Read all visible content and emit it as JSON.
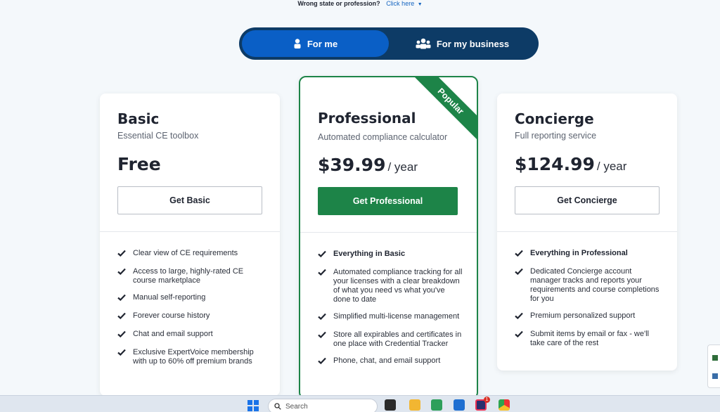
{
  "topnote": {
    "question": "Wrong state or profession?",
    "link": "Click here"
  },
  "toggle": {
    "options": [
      {
        "label": "For me",
        "icon": "person-icon",
        "active": true
      },
      {
        "label": "For my business",
        "icon": "group-icon",
        "active": false
      }
    ]
  },
  "colors": {
    "navy": "#0d3b66",
    "blue": "#0a5fc6",
    "green": "#1d8448"
  },
  "plans": [
    {
      "name": "Basic",
      "subtitle": "Essential CE toolbox",
      "price": "Free",
      "per": "",
      "button": "Get Basic",
      "features": [
        "Clear view of CE requirements",
        "Access to large, highly-rated CE course marketplace",
        "Manual self-reporting",
        "Forever course history",
        "Chat and email support",
        "Exclusive ExpertVoice membership with up to 60% off premium brands"
      ]
    },
    {
      "name": "Professional",
      "subtitle": "Automated compliance calculator",
      "price": "$39.99",
      "per": "/ year",
      "button": "Get Professional",
      "ribbon": "Popular",
      "features": [
        "Everything in Basic",
        "Automated compliance tracking for all your licenses with a clear breakdown of what you need vs what you've done to date",
        "Simplified multi-license management",
        "Store all expirables and certificates in one place with Credential Tracker",
        "Phone, chat, and email support"
      ]
    },
    {
      "name": "Concierge",
      "subtitle": "Full reporting service",
      "price": "$124.99",
      "per": "/ year",
      "button": "Get Concierge",
      "features": [
        "Everything in Professional",
        "Dedicated Concierge account manager tracks and reports your requirements and course completions for you",
        "Premium personalized support",
        "Submit items by email or fax - we'll take care of the rest"
      ]
    }
  ],
  "taskbar": {
    "search_placeholder": "Search",
    "badge": "1"
  }
}
